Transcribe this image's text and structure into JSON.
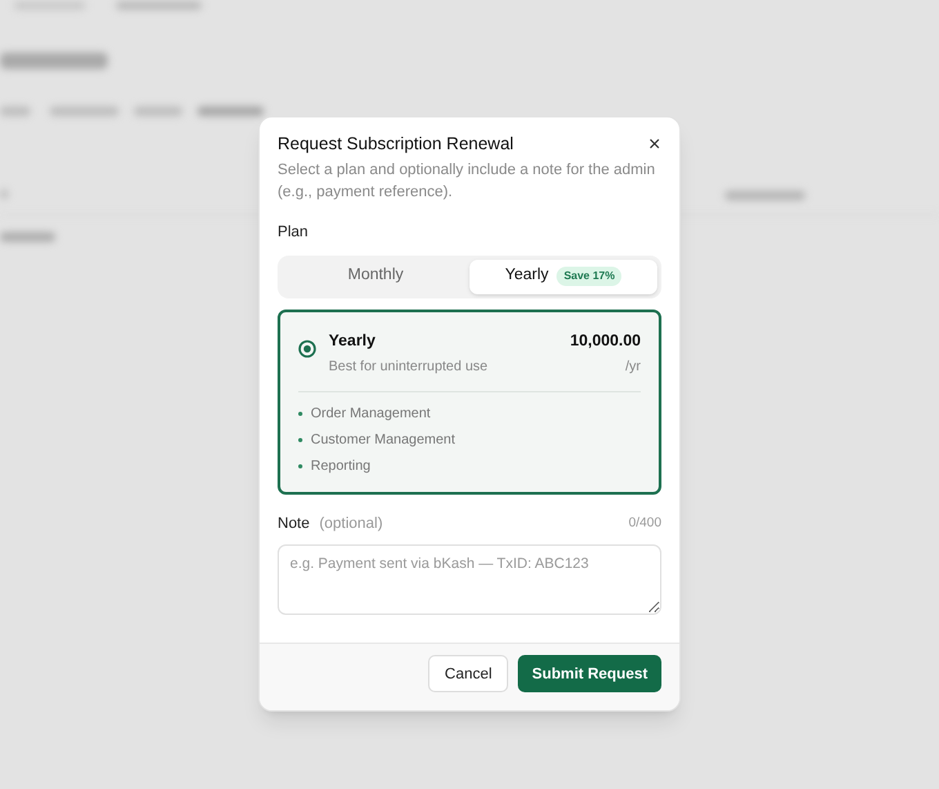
{
  "dialog": {
    "title": "Request Subscription Renewal",
    "description": "Select a plan and optionally include a note for the admin (e.g., payment reference).",
    "plan_label": "Plan",
    "plan_tabs": [
      {
        "label": "Monthly",
        "selected": false
      },
      {
        "label": "Yearly",
        "selected": true,
        "badge": "Save 17%"
      }
    ],
    "plan_card": {
      "name": "Yearly",
      "subtitle": "Best for uninterrupted use",
      "price": "10,000.00",
      "period": "/yr",
      "selected": true,
      "features": [
        "Order Management",
        "Customer Management",
        "Reporting"
      ]
    },
    "note": {
      "label": "Note",
      "hint": "(optional)",
      "counter": "0/400",
      "placeholder": "e.g. Payment sent via bKash — TxID: ABC123"
    },
    "buttons": [
      {
        "label": "Cancel",
        "kind": "secondary"
      },
      {
        "label": "Submit Request",
        "kind": "primary"
      }
    ]
  }
}
